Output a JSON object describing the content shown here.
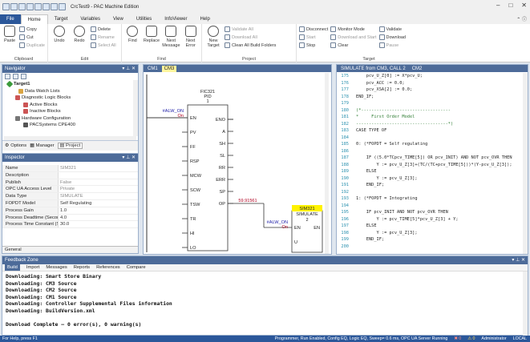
{
  "app": {
    "title": "CrcTest9 - PAC Machine Edition"
  },
  "menu_tabs": [
    "File",
    "Home",
    "Target",
    "Variables",
    "View",
    "Utilities",
    "InfoViewer",
    "Help"
  ],
  "ribbon": {
    "clipboard": {
      "label": "Clipboard",
      "copy": "Copy",
      "cut": "Cut",
      "paste": "Paste",
      "duplicate": "Duplicate"
    },
    "edit": {
      "label": "Edit",
      "undo": "Undo",
      "redo": "Redo",
      "delete": "Delete",
      "rename": "Rename",
      "select_all": "Select All"
    },
    "find": {
      "label": "Find",
      "find": "Find",
      "replace": "Replace",
      "next_message": "Next Message",
      "next_error": "Next Error"
    },
    "project": {
      "label": "Project",
      "new_target": "New Target",
      "validate_all": "Validate All",
      "download_all": "Download All",
      "clean_all": "Clean All Build Folders"
    },
    "target": {
      "label": "Target",
      "disconnect": "Disconnect",
      "start": "Start",
      "stop": "Stop",
      "monitor_mode": "Monitor Mode",
      "download_start": "Download and Start",
      "clear": "Clear",
      "validate": "Validate",
      "download": "Download",
      "pause": "Pause"
    }
  },
  "navigator": {
    "title": "Navigator",
    "items": [
      "Target1",
      "Data Watch Lists",
      "Diagnostic Logic Blocks",
      "Active Blocks",
      "Inactive Blocks",
      "Hardware Configuration",
      "PACSystems CPE400"
    ],
    "tabs": [
      "Options",
      "Manager",
      "Project"
    ]
  },
  "inspector": {
    "title": "Inspector",
    "rows": [
      {
        "k": "Name",
        "v": "SIM321"
      },
      {
        "k": "Description",
        "v": ""
      },
      {
        "k": "Publish",
        "v": "False"
      },
      {
        "k": "OPC UA Access Level",
        "v": "Private"
      },
      {
        "k": "Data Type",
        "v": "SIMULATE"
      },
      {
        "k": "FOPDT Model",
        "v": "Self Regulating"
      },
      {
        "k": "Process Gain",
        "v": "1.0"
      },
      {
        "k": "Process Deadtime (Seconds)",
        "v": "4.0"
      },
      {
        "k": "Process Time Constant (Secor",
        "v": "30.0"
      }
    ],
    "footer": "General"
  },
  "ld_editor": {
    "tabs": [
      "CM1",
      "CM3"
    ],
    "pid": {
      "name": "FIC321",
      "type": "PID",
      "num": "1",
      "in_var": "#ALW_ON",
      "in_state": "On",
      "pins_left": [
        "EN",
        "PV",
        "FF",
        "RSP",
        "MCW",
        "SCW",
        "TSW",
        "TR",
        "HI",
        "LO"
      ],
      "pins_right": [
        "ENO",
        "A",
        "SH",
        "SL",
        "RR",
        "ERR",
        "SP",
        "OP"
      ],
      "op_value": "59.91561"
    },
    "sim": {
      "name": "SIM321",
      "type": "SIMULATE",
      "num": "2",
      "in_var": "#ALW_ON",
      "in_state": "On",
      "pins_left": [
        "EN",
        "U"
      ],
      "pins_right": [
        "EN"
      ]
    }
  },
  "st_editor": {
    "tab": "SIMULATE from CM3, CALL 2",
    "tab2": "CM2",
    "lines": [
      {
        "n": "175",
        "t": "    pcv_U_Z[0] := X*pcv_U;",
        "c": false
      },
      {
        "n": "176",
        "t": "    pcv_ACC := 0.0;",
        "c": false
      },
      {
        "n": "177",
        "t": "    pcv_XSA[2] := 0.0;",
        "c": false
      },
      {
        "n": "178",
        "t": "END_IF;",
        "c": false
      },
      {
        "n": "179",
        "t": "",
        "c": false
      },
      {
        "n": "180",
        "t": "(*-----------------------------------",
        "c": true
      },
      {
        "n": "181",
        "t": "*     First Order Model",
        "c": true
      },
      {
        "n": "182",
        "t": "------------------------------------*)",
        "c": true
      },
      {
        "n": "183",
        "t": "CASE TYPE OF",
        "c": false
      },
      {
        "n": "184",
        "t": "",
        "c": false
      },
      {
        "n": "185",
        "t": "0: (*FOPDT = Self regulating",
        "c": false
      },
      {
        "n": "186",
        "t": "",
        "c": false
      },
      {
        "n": "187",
        "t": "    IF ((5.0*TCpcv_TIME[5]) OR pcv_INIT) AND NOT pcv_OVR THEN",
        "c": false
      },
      {
        "n": "188",
        "t": "        Y := pcv_U_Z[3]+(TC/(TC+pcv_TIME[5]))*(Y-pcv_U_Z[3]);",
        "c": false
      },
      {
        "n": "189",
        "t": "    ELSE",
        "c": false
      },
      {
        "n": "190",
        "t": "        Y := pcv_U_Z[3];",
        "c": false
      },
      {
        "n": "191",
        "t": "    END_IF;",
        "c": false
      },
      {
        "n": "192",
        "t": "",
        "c": false
      },
      {
        "n": "193",
        "t": "1: (*FOPDT = Integrating",
        "c": false
      },
      {
        "n": "194",
        "t": "",
        "c": false
      },
      {
        "n": "195",
        "t": "    IF pcv_INIT AND NOT pcv_OVR THEN",
        "c": false
      },
      {
        "n": "196",
        "t": "        Y := pcv_TIME[5]*pcv_U_Z[3] + Y;",
        "c": false
      },
      {
        "n": "197",
        "t": "    ELSE",
        "c": false
      },
      {
        "n": "198",
        "t": "        Y := pcv_U_Z[3];",
        "c": false
      },
      {
        "n": "199",
        "t": "    END_IF;",
        "c": false
      },
      {
        "n": "200",
        "t": "",
        "c": false
      }
    ]
  },
  "feedback": {
    "title": "Feedback Zone",
    "tabs": [
      "Build",
      "Import",
      "Messages",
      "Reports",
      "References",
      "Compare"
    ],
    "lines": [
      "Downloading:  Smart Store Binary",
      "Downloading:  CM3 Source",
      "Downloading:  CM2 Source",
      "Downloading:  CM1 Source",
      "Downloading:  Controller Supplemental Files information",
      "Downloading:  BuildVersion.xml",
      "",
      "Download Complete – 0 error(s), 0 warning(s)"
    ]
  },
  "status": {
    "left": "For Help, press F1",
    "right": [
      "Programmer, Run Enabled, Config EQ, Logic EQ, Sweep= 0.6 ms, OPC UA Server Running",
      "0",
      "0",
      "Administrator",
      "LOCAL"
    ]
  }
}
